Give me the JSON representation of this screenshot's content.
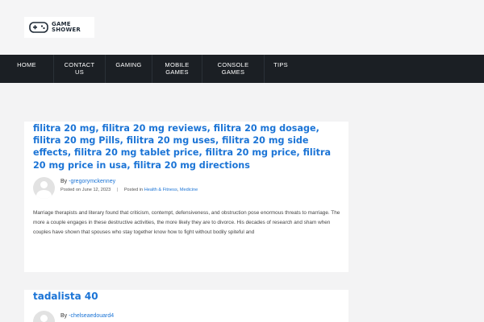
{
  "brand": {
    "line1": "GAME",
    "line2": "SHOWER",
    "icon": "gamepad-icon"
  },
  "nav": {
    "items": [
      {
        "label": "HOME"
      },
      {
        "label": "CONTACT US"
      },
      {
        "label": "GAMING"
      },
      {
        "label": "MOBILE GAMES"
      },
      {
        "label": "CONSOLE GAMES"
      },
      {
        "label": "TIPS"
      }
    ]
  },
  "posts": [
    {
      "title": "filitra 20 mg, filitra 20 mg reviews, filitra 20 mg dosage, filitra 20 mg Pills, filitra 20 mg uses, filitra 20 mg side effects, filitra 20 mg tablet price, filitra 20 mg price, filitra 20 mg price in usa, filitra 20 mg directions",
      "by_label": "By",
      "author": "-gregorymckenney",
      "posted_on_label": "Posted on",
      "date": "June 12, 2023",
      "posted_in_label": "Posted in",
      "category_1": "Health & Fitness",
      "category_2": "Medicine",
      "excerpt": "Marriage therapists and literary found that criticism, contempt, defensiveness, and obstruction pose enormous threats to marriage. The more a couple engages in these destructive activities, the more likely they are to divorce. His decades of research and sham when couples have shown that spouses who stay together know how to fight without bodily spiteful and"
    },
    {
      "title": "tadalista 40",
      "by_label": "By",
      "author": "-chelseaedouard4"
    }
  ],
  "colors": {
    "link": "#1b74d6",
    "nav_bg": "#1b1f24",
    "page_bg": "#f3f3f4"
  }
}
